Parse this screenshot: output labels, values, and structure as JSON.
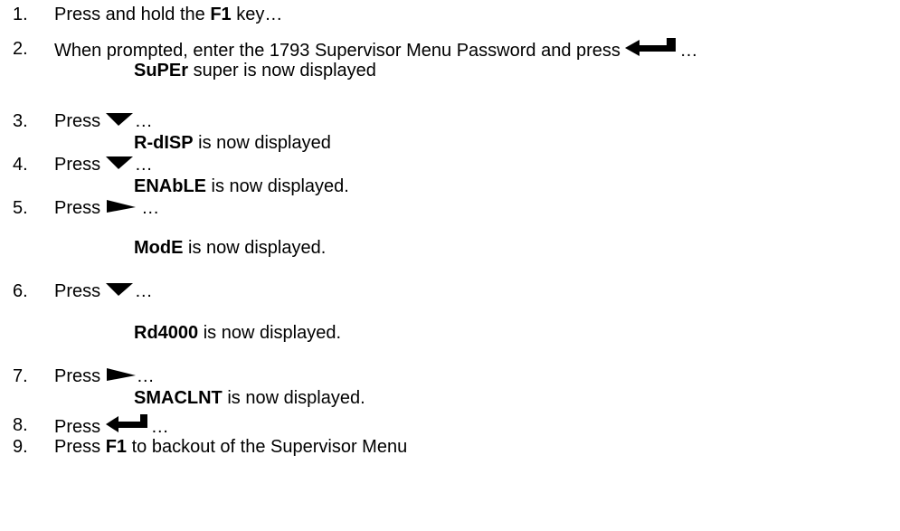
{
  "steps": [
    {
      "num": "1.",
      "pre": "Press and hold the ",
      "bold": "F1",
      "post": " key…"
    },
    {
      "num": "2.",
      "text": "When prompted, enter the 1793 Supervisor Menu Password and press ",
      "icon": "enter-key-icon",
      "ellipsis": "…",
      "result_bold": "SuPEr",
      "result_text": " super is now displayed"
    },
    {
      "num": "3.",
      "text": "Press ",
      "icon": "down-arrow-icon",
      "ellipsis": "…",
      "result_bold": "R-dISP",
      "result_text": " is now displayed"
    },
    {
      "num": "4.",
      "text": "Press ",
      "icon": "down-arrow-icon",
      "ellipsis": "…",
      "result_bold": "ENAbLE",
      "result_text": " is now displayed."
    },
    {
      "num": "5.",
      "text": "Press ",
      "icon": "right-arrow-icon",
      "ellipsis": " …",
      "result_bold": "ModE",
      "result_text": " is now displayed."
    },
    {
      "num": "6.",
      "text": "Press ",
      "icon": "down-arrow-icon",
      "ellipsis": "…",
      "result_bold": "Rd4000",
      "result_text": " is now displayed."
    },
    {
      "num": "7.",
      "text": "Press ",
      "icon": "right-arrow-icon",
      "ellipsis": "…",
      "result_bold": "SMACLNT",
      "result_text": " is now displayed."
    },
    {
      "num": "8.",
      "text": "Press ",
      "icon": "enter-key-icon",
      "ellipsis": "…"
    },
    {
      "num": "9.",
      "pre": "Press ",
      "bold": "F1",
      "post": " to backout of the Supervisor Menu"
    }
  ]
}
